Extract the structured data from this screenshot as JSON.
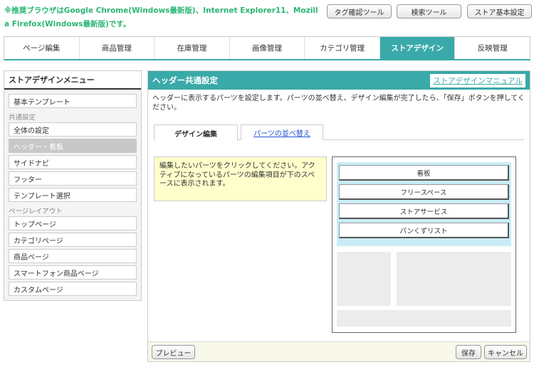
{
  "notice": "※推奨ブラウザはGoogle Chrome(Windows最新版)、Internet Explorer11、Mozilla Firefox(Windows最新版)です。",
  "tools": {
    "tag_check": "タグ確認ツール",
    "search": "検索ツール",
    "store_settings": "ストア基本設定"
  },
  "top_tabs": [
    {
      "label": "ページ編集"
    },
    {
      "label": "商品管理"
    },
    {
      "label": "在庫管理"
    },
    {
      "label": "画像管理"
    },
    {
      "label": "カテゴリ管理"
    },
    {
      "label": "ストアデザイン"
    },
    {
      "label": "反映管理"
    }
  ],
  "sidebar": {
    "title": "ストアデザインメニュー",
    "basic_template": "基本テンプレート",
    "group_common": "共通設定",
    "common_items": [
      {
        "label": "全体の設定"
      },
      {
        "label": "ヘッダー・看板"
      },
      {
        "label": "サイドナビ"
      },
      {
        "label": "フッター"
      },
      {
        "label": "テンプレート選択"
      }
    ],
    "group_layout": "ページレイアウト",
    "layout_items": [
      {
        "label": "トップページ"
      },
      {
        "label": "カテゴリページ"
      },
      {
        "label": "商品ページ"
      },
      {
        "label": "スマートフォン商品ページ"
      },
      {
        "label": "カスタムページ"
      }
    ]
  },
  "main": {
    "title": "ヘッダー共通設定",
    "manual_link": "ストアデザインマニュアル",
    "description": "ヘッダーに表示するパーツを設定します。パーツの並べ替え、デザイン編集が完了したら、「保存」ボタンを押してください。",
    "tab_design": "デザイン編集",
    "tab_reorder": "パーツの並べ替え",
    "info": "編集したいパーツをクリックしてください。アクティブになっているパーツの編集項目が下のスペースに表示されます。",
    "parts": [
      {
        "label": "看板"
      },
      {
        "label": "フリースペース"
      },
      {
        "label": "ストアサービス"
      },
      {
        "label": "パンくずリスト"
      }
    ],
    "preview_button": "プレビュー",
    "save_button": "保存",
    "cancel_button": "キャンセル"
  },
  "colors": {
    "accent": "#3aa9a9",
    "notice": "#2bb673",
    "info_bg": "#ffffcc",
    "preview_header_bg": "#c9ecf6"
  }
}
